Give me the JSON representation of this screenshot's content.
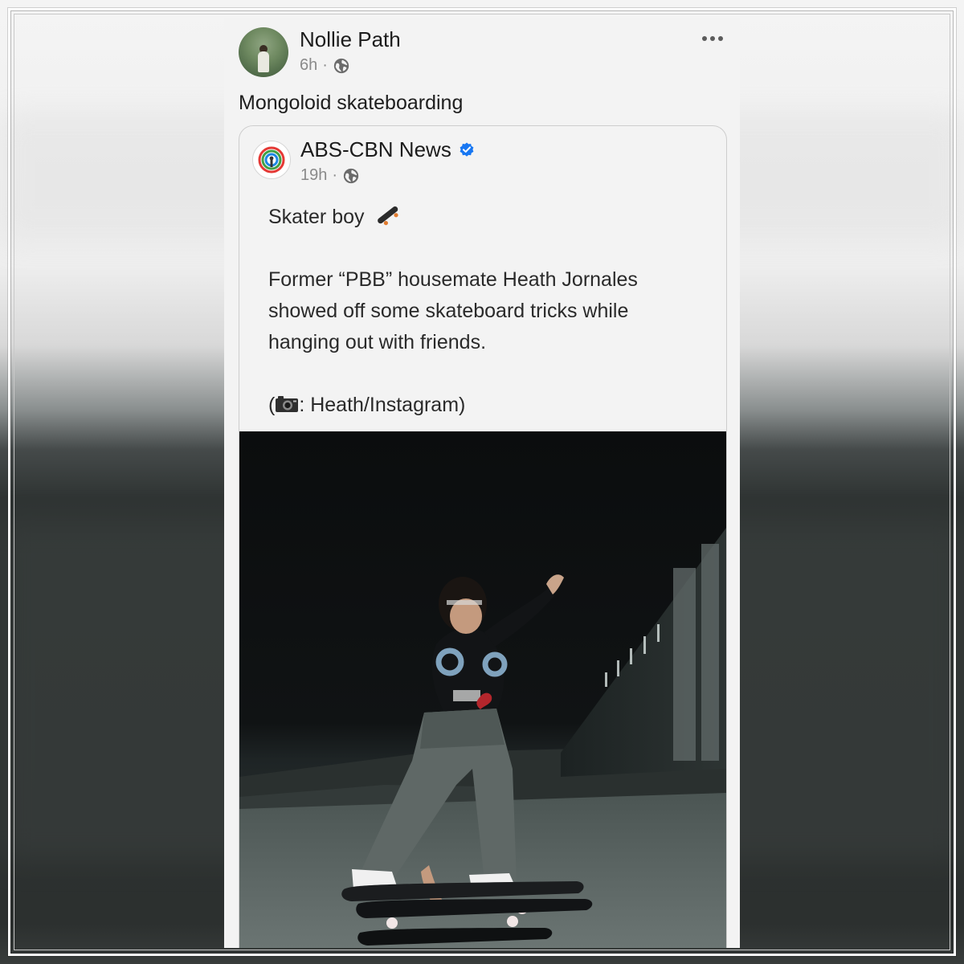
{
  "post": {
    "author": "Nollie Path",
    "time": "6h",
    "separator": "·",
    "text": "Mongoloid skateboarding"
  },
  "shared_post": {
    "page_name": "ABS-CBN News",
    "verified": true,
    "time": "19h",
    "separator": "·",
    "headline": "Skater boy",
    "body": "Former “PBB” housemate Heath Jornales showed off some skateboard tricks while hanging out with friends.",
    "credit_prefix": "(",
    "credit_text": ": Heath/Instagram)"
  },
  "icons": {
    "privacy": "globe-icon",
    "more": "more-horizontal-icon",
    "verified": "verified-badge-icon",
    "skateboard_emoji": "skateboard-emoji-icon",
    "camera_emoji": "camera-emoji-icon"
  },
  "colors": {
    "card_bg": "#f3f3f3",
    "verified_blue": "#1877f2",
    "text_primary": "#1c1c1c",
    "text_meta": "#8a8a8a"
  }
}
